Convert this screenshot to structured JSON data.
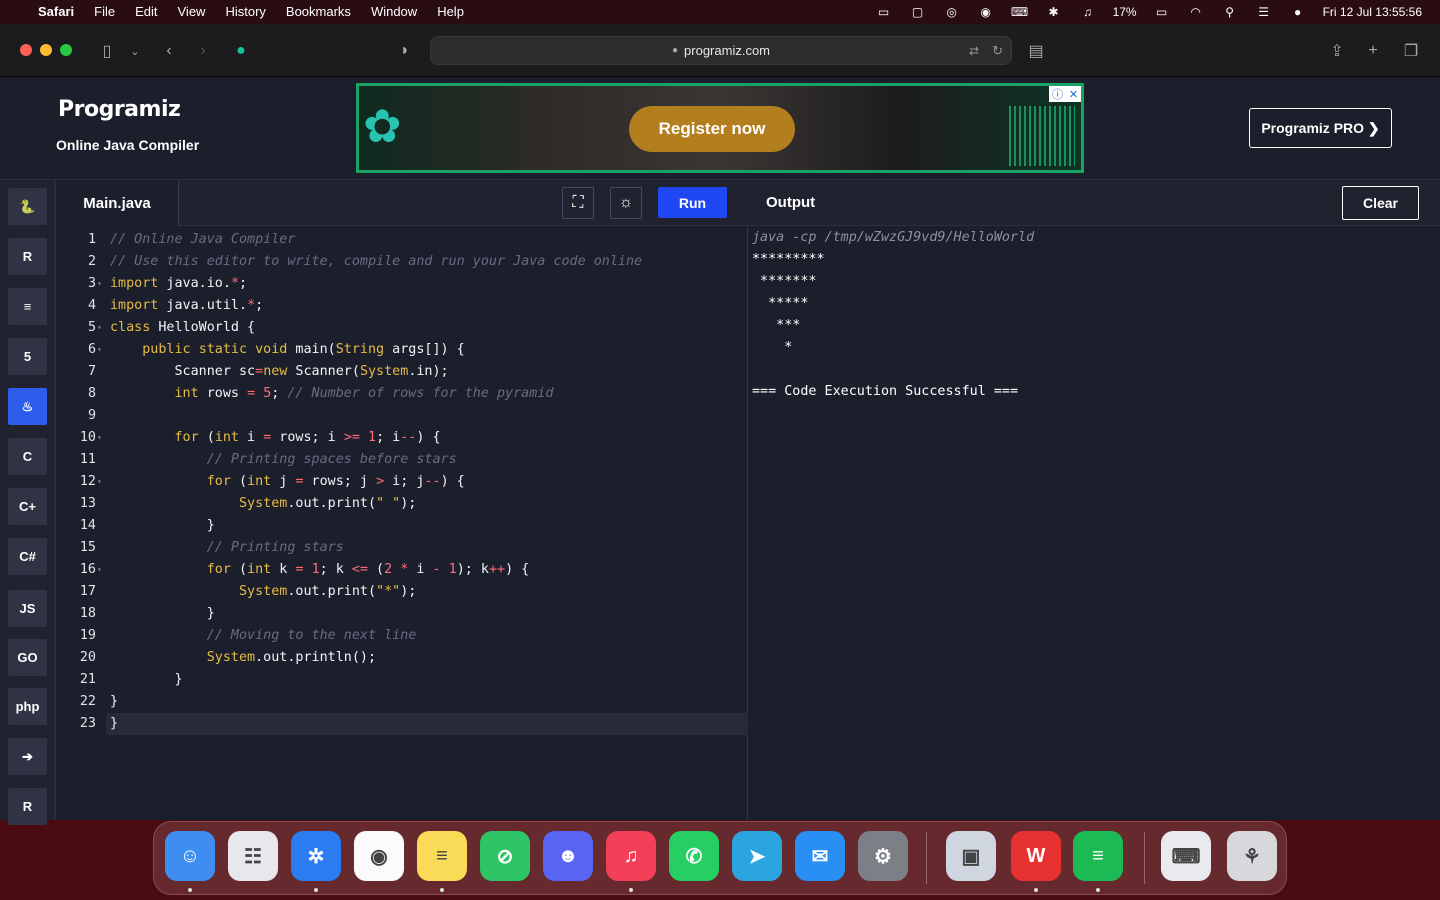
{
  "menubar": {
    "app": "Safari",
    "items": [
      "File",
      "Edit",
      "View",
      "History",
      "Bookmarks",
      "Window",
      "Help"
    ],
    "battery": "17%",
    "datetime": "Fri 12 Jul  13:55:56"
  },
  "browser": {
    "url": "programiz.com"
  },
  "header": {
    "logo": "Programiz",
    "subtitle": "Online Java Compiler",
    "ad_button": "Register now",
    "pro_button": "Programiz PRO ❯"
  },
  "sidebar": {
    "languages": [
      {
        "name": "python",
        "glyph": "🐍"
      },
      {
        "name": "r",
        "glyph": "R"
      },
      {
        "name": "sql",
        "glyph": "≡"
      },
      {
        "name": "html",
        "glyph": "5"
      },
      {
        "name": "java",
        "glyph": "♨"
      },
      {
        "name": "c",
        "glyph": "C"
      },
      {
        "name": "cpp",
        "glyph": "C+"
      },
      {
        "name": "csharp",
        "glyph": "C#"
      },
      {
        "name": "js",
        "glyph": "JS"
      },
      {
        "name": "go",
        "glyph": "GO"
      },
      {
        "name": "php",
        "glyph": "php"
      },
      {
        "name": "swift",
        "glyph": "➔"
      },
      {
        "name": "rust",
        "glyph": "R"
      }
    ],
    "active": "java"
  },
  "editor": {
    "filename": "Main.java",
    "run_label": "Run",
    "lines": [
      "// Online Java Compiler",
      "// Use this editor to write, compile and run your Java code online",
      "import java.io.*;",
      "import java.util.*;",
      "class HelloWorld {",
      "    public static void main(String args[]) {",
      "        Scanner sc=new Scanner(System.in);",
      "        int rows = 5; // Number of rows for the pyramid",
      "",
      "        for (int i = rows; i >= 1; i--) {",
      "            // Printing spaces before stars",
      "            for (int j = rows; j > i; j--) {",
      "                System.out.print(\" \");",
      "            }",
      "            // Printing stars",
      "            for (int k = 1; k <= (2 * i - 1); k++) {",
      "                System.out.print(\"*\");",
      "            }",
      "            // Moving to the next line",
      "            System.out.println();",
      "        }",
      "}",
      "}"
    ]
  },
  "output": {
    "title": "Output",
    "clear_label": "Clear",
    "lines": [
      "java -cp /tmp/wZwzGJ9vd9/HelloWorld",
      "*********",
      " *******",
      "  *****",
      "   ***",
      "    *",
      "",
      "=== Code Execution Successful ==="
    ]
  },
  "dock": {
    "apps": [
      {
        "name": "finder",
        "glyph": "☺",
        "color": "#3d8ef0",
        "running": true
      },
      {
        "name": "launchpad",
        "glyph": "☷",
        "color": "#e8e8ec",
        "running": false
      },
      {
        "name": "safari",
        "glyph": "✲",
        "color": "#2b7cf0",
        "running": true
      },
      {
        "name": "chrome",
        "glyph": "◉",
        "color": "#fbfbfb",
        "running": false
      },
      {
        "name": "notes",
        "glyph": "≡",
        "color": "#fadb57",
        "running": true
      },
      {
        "name": "focus",
        "glyph": "⊘",
        "color": "#2fc567",
        "running": false
      },
      {
        "name": "discord",
        "glyph": "☻",
        "color": "#5865f2",
        "running": false
      },
      {
        "name": "music",
        "glyph": "♫",
        "color": "#f23e57",
        "running": true
      },
      {
        "name": "whatsapp",
        "glyph": "✆",
        "color": "#26cf63",
        "running": false
      },
      {
        "name": "telegram",
        "glyph": "➤",
        "color": "#2aa5e0",
        "running": false
      },
      {
        "name": "mail",
        "glyph": "✉",
        "color": "#2a8ff5",
        "running": false
      },
      {
        "name": "settings",
        "glyph": "⚙",
        "color": "#7d7f87",
        "running": false
      },
      {
        "name": "preview",
        "glyph": "▣",
        "color": "#cfd6e0",
        "running": false
      },
      {
        "name": "wps",
        "glyph": "W",
        "color": "#e83131",
        "running": true
      },
      {
        "name": "spotify",
        "glyph": "≡",
        "color": "#1db954",
        "running": true
      },
      {
        "name": "keyboard",
        "glyph": "⌨",
        "color": "#e9eaee",
        "running": false
      },
      {
        "name": "trash",
        "glyph": "⚘",
        "color": "#d6d8dc",
        "running": false
      }
    ]
  }
}
